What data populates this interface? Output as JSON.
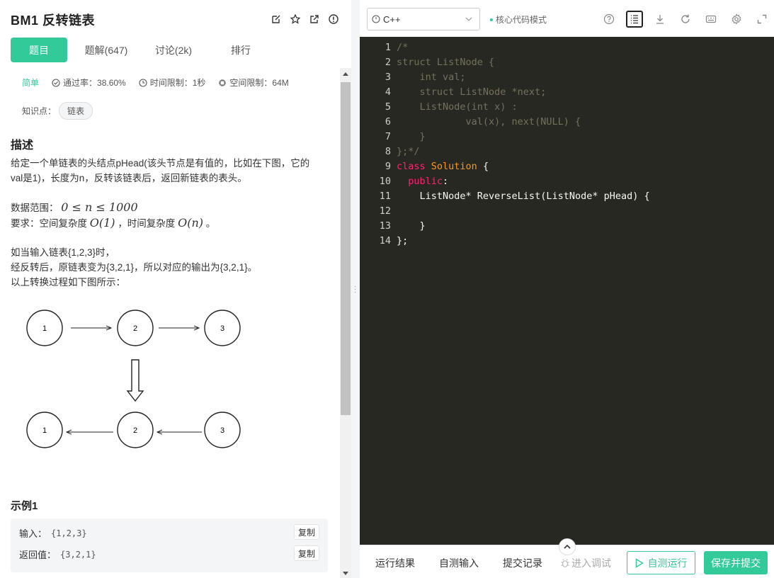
{
  "problem": {
    "title": "BM1  反转链表",
    "tabs": [
      "题目",
      "题解(647)",
      "讨论(2k)",
      "排行"
    ],
    "difficulty": "简单",
    "pass_rate": "通过率：38.60%",
    "time_limit": "时间限制：1秒",
    "space_limit": "空间限制：64M",
    "knowledge_label": "知识点：",
    "knowledge_tag": "链表",
    "desc_heading": "描述",
    "desc_line1": "给定一个单链表的头结点pHead(该头节点是有值的，比如在下图，它的",
    "desc_line2": "val是1)，长度为n，反转该链表后，返回新链表的表头。",
    "range_label": "数据范围：",
    "range_math": "0 ≤ n ≤ 1000",
    "req_label": "要求：空间复杂度",
    "req_math1": "O(1)",
    "req_mid": "，时间复杂度",
    "req_math2": "O(n)",
    "req_end": "。",
    "ex_line1": "如当输入链表{1,2,3}时，",
    "ex_line2": "经反转后，原链表变为{3,2,1}，所以对应的输出为{3,2,1}。",
    "ex_line3": "以上转换过程如下图所示：",
    "diagram_top": [
      "1",
      "2",
      "3"
    ],
    "diagram_bottom": [
      "1",
      "2",
      "3"
    ],
    "example_heading": "示例1",
    "input_label": "输入：",
    "input_value": "{1,2,3}",
    "output_label": "返回值：",
    "output_value": "{3,2,1}",
    "copy_label": "复制"
  },
  "editor": {
    "language": "C++",
    "mode": "核心代码模式",
    "line_numbers": [
      "1",
      "2",
      "3",
      "4",
      "5",
      "6",
      "7",
      "8",
      "9",
      "10",
      "11",
      "12",
      "13",
      "14"
    ],
    "lines": [
      "/*",
      "struct ListNode {",
      "    int val;",
      "    struct ListNode *next;",
      "    ListNode(int x) :",
      "            val(x), next(NULL) {",
      "    }",
      "};*/",
      "class",
      "Solution",
      "{",
      "public",
      ":",
      "    ListNode* ReverseList(ListNode* pHead) {",
      "",
      "    }",
      "};"
    ]
  },
  "bottom": {
    "run_result": "运行结果",
    "self_input": "自测输入",
    "submit_record": "提交记录",
    "debug": "进入调试",
    "self_run": "自测运行",
    "save_submit": "保存并提交"
  },
  "colors": {
    "accent": "#32ca99",
    "editor_bg": "#272822"
  }
}
